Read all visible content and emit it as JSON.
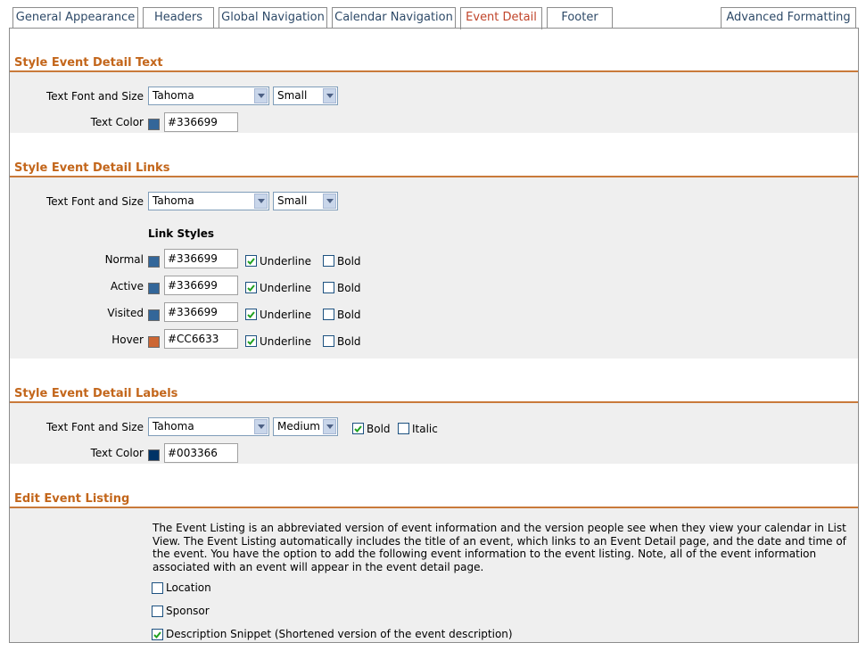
{
  "tabs": [
    {
      "label": "General Appearance"
    },
    {
      "label": "Headers"
    },
    {
      "label": "Global Navigation"
    },
    {
      "label": "Calendar Navigation"
    },
    {
      "label": "Event Detail",
      "active": true
    },
    {
      "label": "Footer"
    },
    {
      "label": "Advanced Formatting"
    }
  ],
  "sections": {
    "text": {
      "title": "Style Event Detail Text",
      "font_label": "Text Font and Size",
      "font_value": "Tahoma",
      "size_value": "Small",
      "color_label": "Text Color",
      "color_value": "#336699"
    },
    "links": {
      "title": "Style Event Detail Links",
      "font_label": "Text Font and Size",
      "font_value": "Tahoma",
      "size_value": "Small",
      "link_styles_label": "Link Styles",
      "underline_label": "Underline",
      "bold_label": "Bold",
      "rows": [
        {
          "label": "Normal",
          "color": "#336699",
          "underline": true,
          "bold": false
        },
        {
          "label": "Active",
          "color": "#336699",
          "underline": true,
          "bold": false
        },
        {
          "label": "Visited",
          "color": "#336699",
          "underline": true,
          "bold": false
        },
        {
          "label": "Hover",
          "color": "#CC6633",
          "underline": true,
          "bold": false
        }
      ]
    },
    "labels": {
      "title": "Style Event Detail Labels",
      "font_label": "Text Font and Size",
      "font_value": "Tahoma",
      "size_value": "Medium",
      "bold_label": "Bold",
      "bold_checked": true,
      "italic_label": "Italic",
      "italic_checked": false,
      "color_label": "Text Color",
      "color_value": "#003366"
    },
    "listing": {
      "title": "Edit Event Listing",
      "description": "The Event Listing is an abbreviated version of event information and the version people see when they view your calendar in List View. The Event Listing automatically includes the title of an event, which links to an Event Detail page, and the date and time of the event. You have the option to add the following event information to the event listing. Note, all of the event information associated with an event will appear in the event detail page.",
      "options": [
        {
          "label": "Location",
          "checked": false
        },
        {
          "label": "Sponsor",
          "checked": false
        },
        {
          "label": "Description Snippet (Shortened version of the event description)",
          "checked": true
        }
      ]
    }
  },
  "colors": {
    "accent": "#c3661b",
    "tab_text": "#2e4a68",
    "tab_active_text": "#c0442a",
    "panel_bg": "#efefef",
    "swatch_blue": "#336699",
    "swatch_orange": "#CC6633",
    "swatch_navy": "#003366"
  }
}
